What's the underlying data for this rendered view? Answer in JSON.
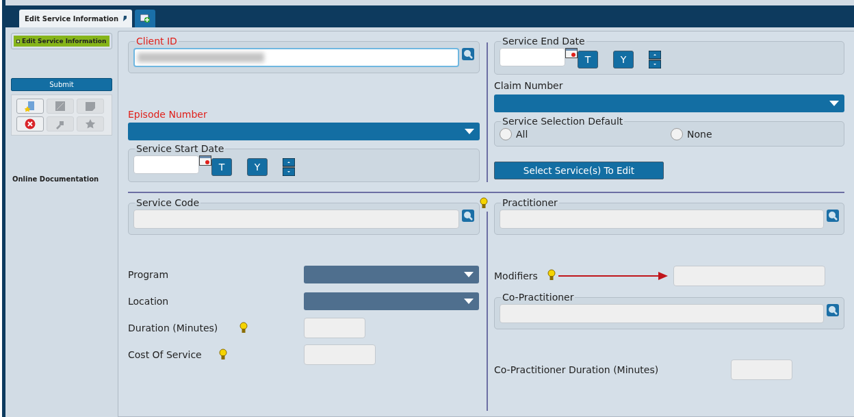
{
  "tabs": [
    {
      "label": "Edit Service Information",
      "selected": true,
      "pinned": true
    },
    {
      "kind": "add",
      "selected": false
    }
  ],
  "sidebar": {
    "items": [
      {
        "label": "Edit Service Information",
        "selected": true
      }
    ],
    "submit": "Submit",
    "tools": [
      {
        "kind": "new",
        "disabled": false
      },
      {
        "kind": "image",
        "disabled": true
      },
      {
        "kind": "note",
        "disabled": true
      },
      {
        "kind": "cancel",
        "disabled": false
      },
      {
        "kind": "puzzle",
        "disabled": true
      },
      {
        "kind": "star",
        "disabled": true
      }
    ],
    "link": "Online Documentation"
  },
  "client_id": {
    "label": "Client ID",
    "required": true,
    "redacted": true
  },
  "episode_number": {
    "label": "Episode Number",
    "required": true,
    "disabled": false
  },
  "service_start_date": {
    "label": "Service Start Date",
    "today": "T",
    "yesterday": "Y"
  },
  "service_end_date": {
    "label": "Service End Date",
    "today": "T",
    "yesterday": "Y"
  },
  "claim_number": {
    "label": "Claim Number",
    "disabled": false
  },
  "service_selection_default": {
    "label": "Service Selection Default",
    "options": [
      {
        "label": "All",
        "selected": false
      },
      {
        "label": "None",
        "selected": false
      }
    ]
  },
  "select_button": "Select Service(s) To Edit",
  "service_code": {
    "label": "Service Code",
    "hint": true
  },
  "program": {
    "label": "Program",
    "disabled": true
  },
  "location": {
    "label": "Location",
    "disabled": true
  },
  "duration": {
    "label": "Duration (Minutes)",
    "hint": true
  },
  "cost": {
    "label": "Cost Of Service",
    "hint": true
  },
  "practitioner": {
    "label": "Practitioner"
  },
  "modifiers": {
    "label": "Modifiers",
    "hint": true,
    "arrow": true
  },
  "co_practitioner": {
    "label": "Co-Practitioner"
  },
  "co_duration": {
    "label": "Co-Practitioner Duration (Minutes)"
  }
}
